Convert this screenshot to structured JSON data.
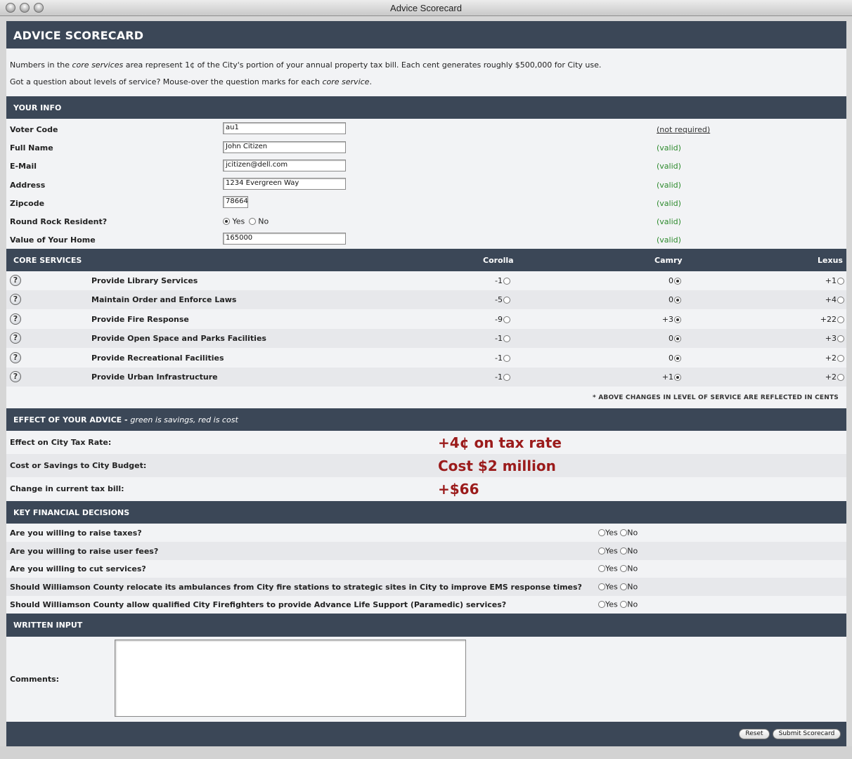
{
  "window": {
    "title": "Advice Scorecard"
  },
  "header": {
    "title": "ADVICE SCORECARD"
  },
  "intro": {
    "line1_a": "Numbers in the ",
    "line1_em": "core services",
    "line1_b": " area represent 1¢ of the City's portion of your annual property tax bill. Each cent generates roughly $500,000 for City use.",
    "line2_a": "Got a question about levels of service? Mouse-over the question marks for each ",
    "line2_em": "core service",
    "line2_b": "."
  },
  "your_info": {
    "heading": "YOUR INFO",
    "voter_code": {
      "label": "Voter Code",
      "value": "au1",
      "status": "(not required)"
    },
    "full_name": {
      "label": "Full Name",
      "value": "John Citizen",
      "status": "(valid)"
    },
    "email": {
      "label": "E-Mail",
      "value": "jcitizen@dell.com",
      "status": "(valid)"
    },
    "address": {
      "label": "Address",
      "value": "1234 Evergreen Way",
      "status": "(valid)"
    },
    "zipcode": {
      "label": "Zipcode",
      "value": "78664",
      "status": "(valid)"
    },
    "resident": {
      "label": "Round Rock Resident?",
      "yes": "Yes",
      "no": "No",
      "selected": "Yes",
      "status": "(valid)"
    },
    "home_value": {
      "label": "Value of Your Home",
      "value": "165000",
      "status": "(valid)"
    }
  },
  "core_services": {
    "heading": "CORE SERVICES",
    "col_corolla": "Corolla",
    "col_camry": "Camry",
    "col_lexus": "Lexus",
    "help": "?",
    "items": [
      {
        "name": "Provide Library Services",
        "corolla": "-1",
        "camry": "0",
        "lexus": "+1",
        "selected": "camry"
      },
      {
        "name": "Maintain Order and Enforce Laws",
        "corolla": "-5",
        "camry": "0",
        "lexus": "+4",
        "selected": "camry"
      },
      {
        "name": "Provide Fire Response",
        "corolla": "-9",
        "camry": "+3",
        "lexus": "+22",
        "selected": "camry"
      },
      {
        "name": "Provide Open Space and Parks Facilities",
        "corolla": "-1",
        "camry": "0",
        "lexus": "+3",
        "selected": "camry"
      },
      {
        "name": "Provide Recreational Facilities",
        "corolla": "-1",
        "camry": "0",
        "lexus": "+2",
        "selected": "camry"
      },
      {
        "name": "Provide Urban Infrastructure",
        "corolla": "-1",
        "camry": "+1",
        "lexus": "+2",
        "selected": "camry"
      }
    ],
    "note": "* ABOVE CHANGES IN LEVEL OF SERVICE ARE REFLECTED IN CENTS"
  },
  "effect": {
    "heading_a": "EFFECT OF YOUR ADVICE - ",
    "heading_em": "green is savings, red is cost",
    "tax_rate": {
      "label": "Effect on City Tax Rate:",
      "value": "+4¢ on tax rate"
    },
    "budget": {
      "label": "Cost or Savings to City Budget:",
      "value": "Cost $2 million"
    },
    "tax_bill": {
      "label": "Change in current tax bill:",
      "value": "+$66"
    },
    "cost_color": "#9b1b1b"
  },
  "key_decisions": {
    "heading": "KEY FINANCIAL DECISIONS",
    "yes": "Yes",
    "no": "No",
    "questions": [
      "Are you willing to raise taxes?",
      "Are you willing to raise user fees?",
      "Are you willing to cut services?",
      "Should Williamson County relocate its ambulances from City fire stations to strategic sites in City to improve EMS response times?",
      "Should Williamson County allow qualified City Firefighters to provide Advance Life Support (Paramedic) services?"
    ]
  },
  "written_input": {
    "heading": "WRITTEN INPUT",
    "comments_label": "Comments:",
    "comments_value": ""
  },
  "footer": {
    "reset_label": "Reset",
    "submit_label": "Submit Scorecard"
  },
  "colors": {
    "header_bg": "#3b4757",
    "valid_green": "#2c8a2c",
    "page_bg": "#f2f3f5"
  }
}
